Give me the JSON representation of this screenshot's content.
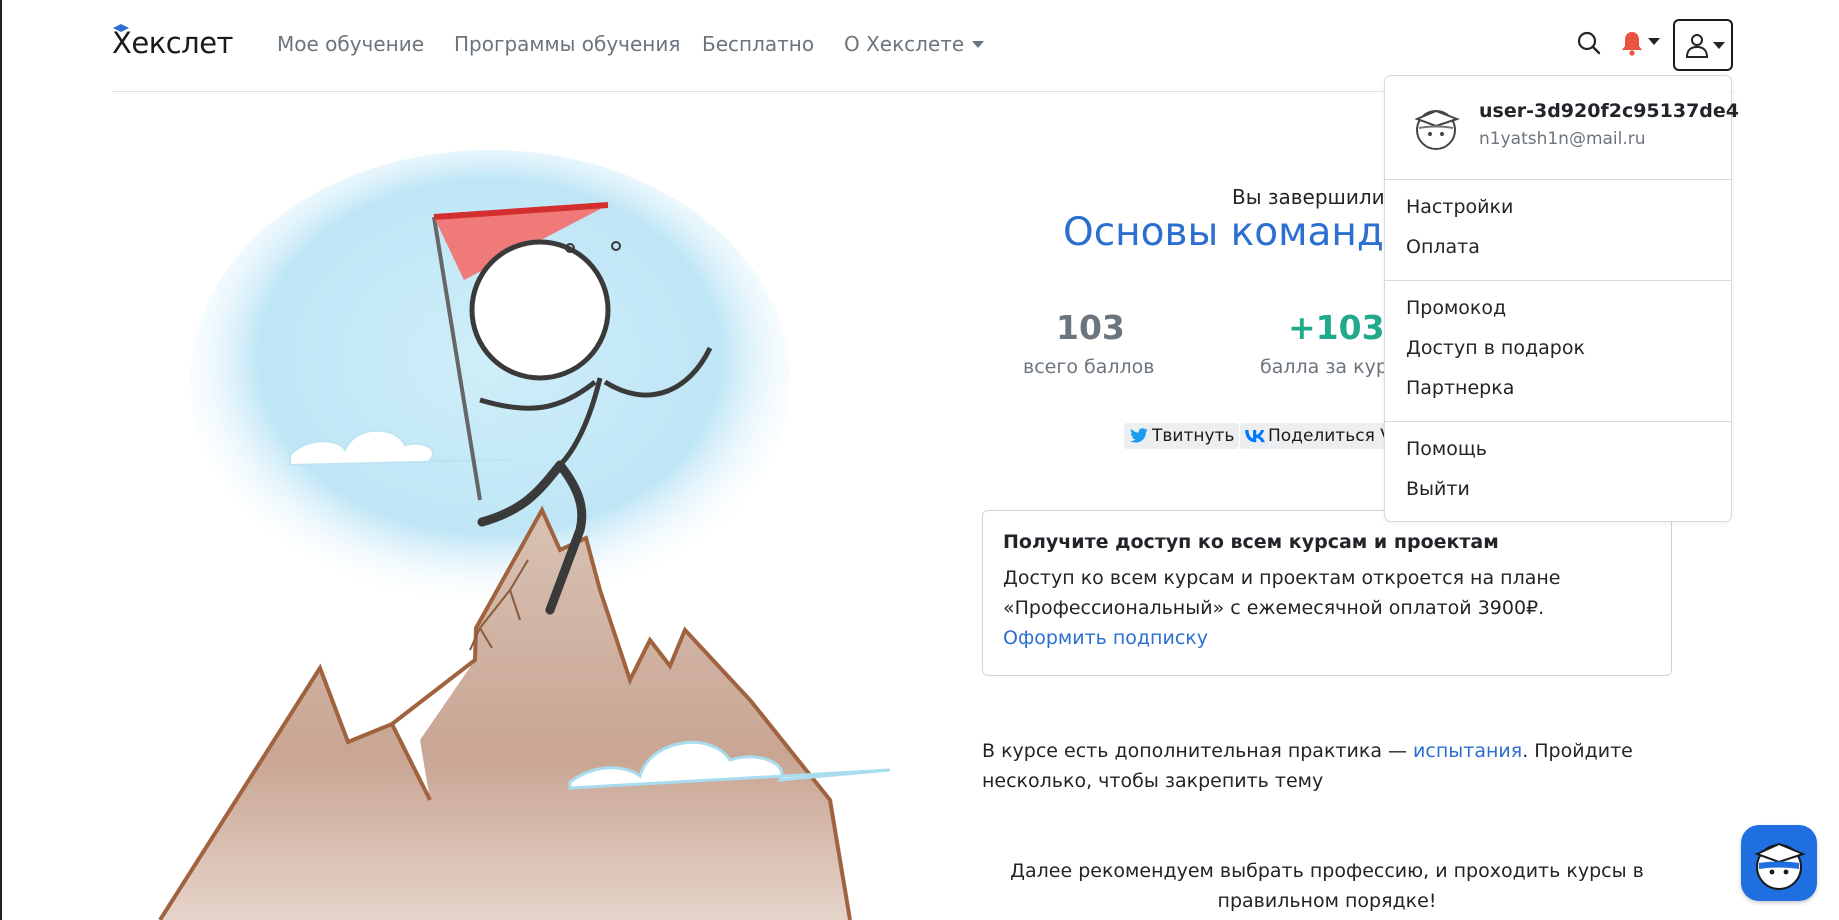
{
  "header": {
    "logo": "Хекслет",
    "nav": {
      "my_learning": "Мое обучение",
      "programs": "Программы обучения",
      "free": "Бесплатно",
      "about": "О Хекслете"
    }
  },
  "main": {
    "finished_text": "Вы завершили к",
    "course_title": "Основы командн",
    "stats": {
      "total_value": "103",
      "total_label": "всего баллов",
      "course_value": "+103",
      "course_label": "балла за кур"
    },
    "share": {
      "tweet": "Твитнуть",
      "vk": "Поделиться VI"
    },
    "promo": {
      "title": "Получите доступ ко всем курсам и проектам",
      "text": "Доступ ко всем курсам и проектам откроется на плане «Профессиональный» с ежемесячной оплатой 3900₽.",
      "link": "Оформить подписку"
    },
    "practice": {
      "before": "В курсе есть дополнительная практика — ",
      "link": "испытания",
      "after": ". Пройдите несколько, чтобы закрепить тему"
    },
    "recommend": "Далее рекомендуем выбрать профессию, и проходить курсы в правильном порядке!"
  },
  "dropdown": {
    "username": "user-3d920f2c95137de4",
    "email": "n1yatsh1n@mail.ru",
    "items": {
      "settings": "Настройки",
      "payment": "Оплата",
      "promo": "Промокод",
      "gift": "Доступ в подарок",
      "partner": "Партнерка",
      "help": "Помощь",
      "logout": "Выйти"
    }
  },
  "colors": {
    "accent_blue": "#2c6fd1",
    "success_green": "#20a98b",
    "notification_red": "#e8543f",
    "fab_blue": "#1f6fe0"
  },
  "icons": {
    "search": "search-icon",
    "bell": "bell-icon",
    "user": "user-icon",
    "twitter": "twitter-icon",
    "vk": "vk-icon",
    "avatar": "hexlet-avatar-icon",
    "help": "help-bot-icon"
  }
}
